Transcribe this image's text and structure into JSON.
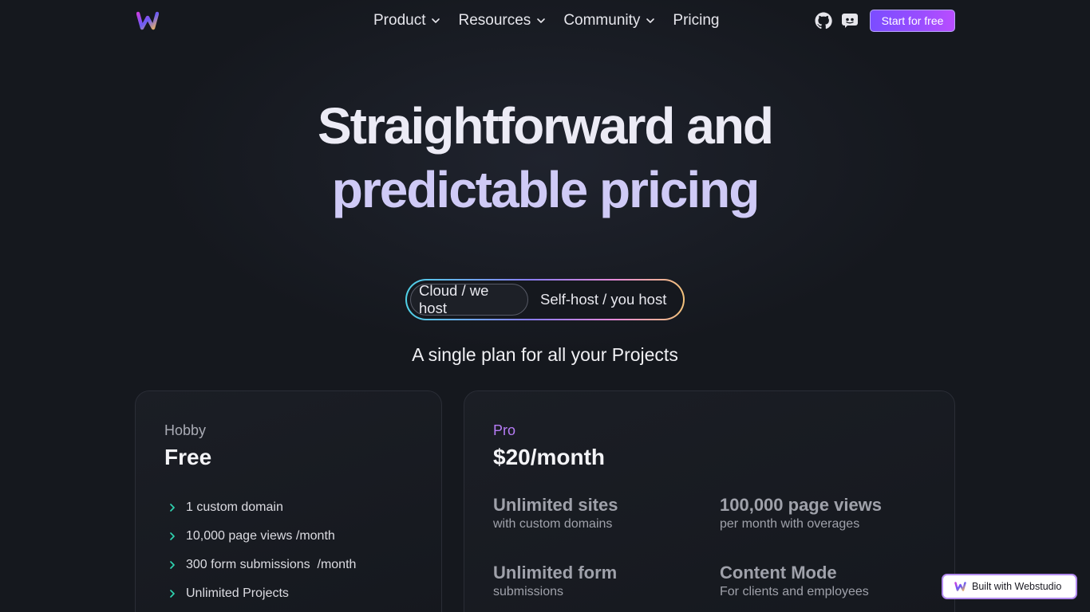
{
  "nav": {
    "items": [
      {
        "label": "Product",
        "has_dropdown": true
      },
      {
        "label": "Resources",
        "has_dropdown": true
      },
      {
        "label": "Community",
        "has_dropdown": true
      },
      {
        "label": "Pricing",
        "has_dropdown": false
      }
    ],
    "icons": [
      "github-icon",
      "discord-icon"
    ],
    "cta_label": "Start for free"
  },
  "hero": {
    "line1": "Straightforward and",
    "line2": "predictable pricing"
  },
  "toggle": {
    "options": [
      "Cloud / we host",
      "Self-host / you host"
    ],
    "selected": "Cloud / we host"
  },
  "subtitle": "A single plan for all your Projects",
  "plans": {
    "hobby": {
      "name": "Hobby",
      "price": "Free",
      "features": [
        "1 custom domain",
        "10,000 page views /month",
        "300 form submissions  /month",
        "Unlimited Projects"
      ]
    },
    "pro": {
      "name": "Pro",
      "price": "$20/month",
      "features": [
        {
          "title": "Unlimited sites",
          "subtitle": "with custom domains"
        },
        {
          "title": "100,000 page views",
          "subtitle": "per month with overages"
        },
        {
          "title": "Unlimited form",
          "subtitle": "submissions"
        },
        {
          "title": "Content Mode",
          "subtitle": "For clients and employees"
        }
      ]
    }
  },
  "badge": {
    "label": "Built with Webstudio"
  },
  "colors": {
    "background": "#15181e",
    "accent_purple": "#8a4dff",
    "check_green": "#2fd3b0",
    "pro_label": "#b67cf5"
  }
}
